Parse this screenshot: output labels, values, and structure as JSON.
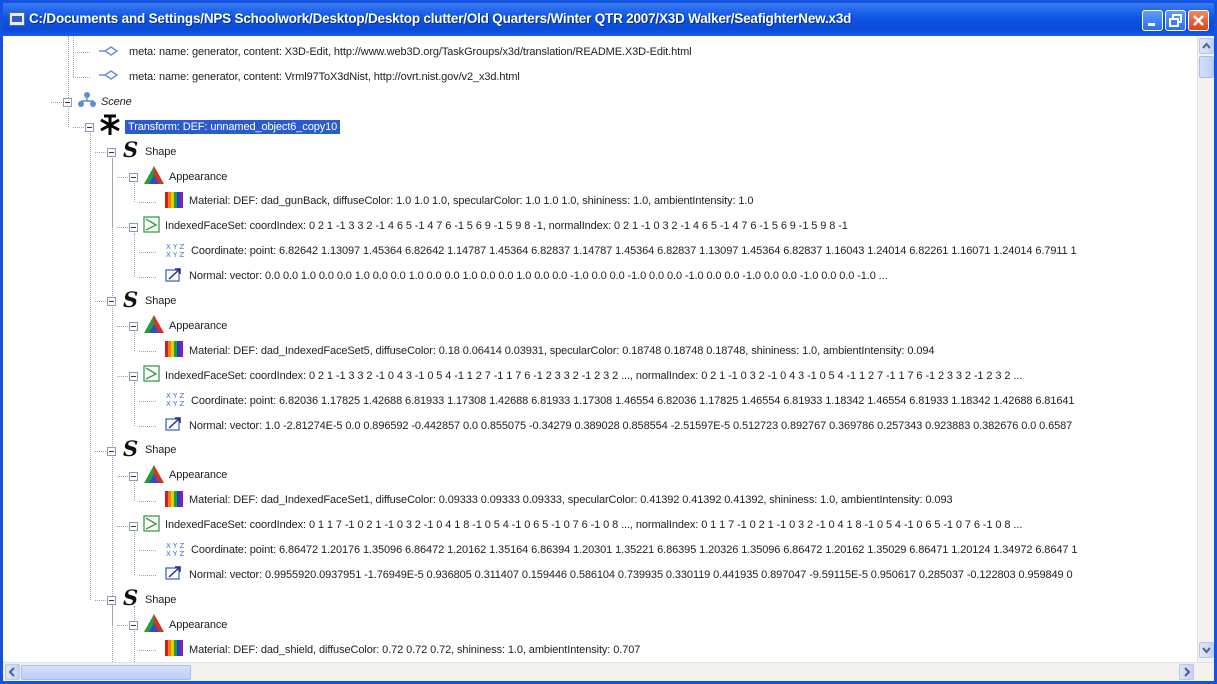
{
  "window": {
    "title": "C:/Documents and Settings/NPS Schoolwork/Desktop/Desktop clutter/Old Quarters/Winter QTR 2007/X3D Walker/SeafighterNew.x3d"
  },
  "tree": {
    "rows": [
      {
        "icon": "meta-icon",
        "text": "meta:  name: generator,  content: X3D-Edit, http://www.web3D.org/TaskGroups/x3d/translation/README.X3D-Edit.html"
      },
      {
        "icon": "meta-icon",
        "text": "meta:  name: generator,  content: Vrml97ToX3dNist,  http://ovrt.nist.gov/v2_x3d.html"
      },
      {
        "icon": "scene-icon",
        "text": "Scene"
      },
      {
        "icon": "transform-icon",
        "text": "Transform:  DEF: unnamed_object6_copy10"
      },
      {
        "icon": "shape-icon",
        "text": "Shape"
      },
      {
        "icon": "appearance-icon",
        "text": "Appearance"
      },
      {
        "icon": "material-icon",
        "text": "Material:  DEF: dad_gunBack,  diffuseColor: 1.0 1.0 1.0,  specularColor: 1.0 1.0 1.0,  shininess: 1.0,  ambientIntensity: 1.0"
      },
      {
        "icon": "indexedfaceset-icon",
        "text": "IndexedFaceSet:  coordIndex:  0 2 1 -1 3 3 2 -1 4 6 5 -1 4 7 6 -1 5 6 9 -1 5 9 8 -1,  normalIndex:  0 2 1 -1 0 3 2 -1 4 6 5 -1 4 7 6 -1 5 6 9 -1 5 9 8 -1"
      },
      {
        "icon": "coordinate-icon",
        "text": "Coordinate:  point:  6.82642 1.13097 1.45364 6.82642 1.14787 1.45364 6.82837 1.14787 1.45364 6.82837 1.13097 1.45364 6.82837 1.16043 1.24014 6.82261 1.16071 1.24014 6.7911 1"
      },
      {
        "icon": "normal-icon",
        "text": "Normal:  vector:  0.0 0.0 1.0 0.0 0.0 1.0 0.0 0.0 1.0 0.0 0.0 1.0 0.0 0.0 1.0 0.0 0.0 -1.0 0.0 0.0 -1.0 0.0 0.0 -1.0 0.0 0.0 -1.0 0.0 0.0 -1.0 0.0 0.0 -1.0 ..."
      },
      {
        "icon": "shape-icon",
        "text": "Shape"
      },
      {
        "icon": "appearance-icon",
        "text": "Appearance"
      },
      {
        "icon": "material-icon",
        "text": "Material:  DEF: dad_IndexedFaceSet5,  diffuseColor: 0.18 0.06414 0.03931,  specularColor: 0.18748 0.18748 0.18748,  shininess: 1.0,  ambientIntensity: 0.094"
      },
      {
        "icon": "indexedfaceset-icon",
        "text": "IndexedFaceSet:  coordIndex:  0 2 1 -1 3 3 2 -1 0 4 3 -1 0 5 4 -1 1 2 7 -1 1 7 6 -1 2 3 3 2 -1 2 3 2 ...,  normalIndex:  0 2 1 -1 0 3 2 -1 0 4 3 -1 0 5 4 -1 1 2 7 -1 1 7 6 -1 2 3 3 2 -1 2 3 2 ..."
      },
      {
        "icon": "coordinate-icon",
        "text": "Coordinate:  point:  6.82036 1.17825 1.42688 6.81933 1.17308 1.42688 6.81933 1.17308 1.46554 6.82036 1.17825 1.46554 6.81933 1.18342 1.46554 6.81933 1.18342 1.42688 6.81641"
      },
      {
        "icon": "normal-icon",
        "text": "Normal:  vector:  1.0 -2.81274E-5 0.0 0.896592 -0.442857 0.0 0.855075 -0.34279 0.389028 0.858554 -2.51597E-5 0.512723 0.892767 0.369786 0.257343 0.923883 0.382676 0.0 0.6587"
      },
      {
        "icon": "shape-icon",
        "text": "Shape"
      },
      {
        "icon": "appearance-icon",
        "text": "Appearance"
      },
      {
        "icon": "material-icon",
        "text": "Material:  DEF: dad_IndexedFaceSet1,  diffuseColor: 0.09333 0.09333 0.09333,  specularColor: 0.41392 0.41392 0.41392,  shininess: 1.0,  ambientIntensity: 0.093"
      },
      {
        "icon": "indexedfaceset-icon",
        "text": "IndexedFaceSet:  coordIndex:  0 1 1 7 -1 0 2 1 -1 0 3 2 -1 0 4 1 8 -1 0 5 4 -1 0 6 5 -1 0 7 6 -1 0 8 ...,  normalIndex:  0 1 1 7 -1 0 2 1 -1 0 3 2 -1 0 4 1 8 -1 0 5 4 -1 0 6 5 -1 0 7 6 -1 0 8 ..."
      },
      {
        "icon": "coordinate-icon",
        "text": "Coordinate:  point:  6.86472 1.20176 1.35096 6.86472 1.20162 1.35164 6.86394 1.20301 1.35221 6.86395 1.20326 1.35096 6.86472 1.20162 1.35029 6.86471 1.20124 1.34972 6.8647 1"
      },
      {
        "icon": "normal-icon",
        "text": "Normal:  vector:  0.9955920.0937951 -1.76949E-5 0.936805 0.311407 0.159446 0.586104 0.739935 0.330119 0.441935 0.897047 -9.59115E-5 0.950617 0.285037 -0.122803 0.959849 0"
      },
      {
        "icon": "shape-icon",
        "text": "Shape"
      },
      {
        "icon": "appearance-icon",
        "text": "Appearance"
      },
      {
        "icon": "material-icon",
        "text": "Material:  DEF: dad_shield,  diffuseColor: 0.72 0.72 0.72,  shininess: 1.0,  ambientIntensity: 0.707"
      }
    ]
  },
  "colors": {
    "titlebar": "#0d55e5",
    "selection": "#2a5ccf",
    "tree_lines": "#9aa5b8",
    "scrollbar": "#c4d3f6"
  }
}
